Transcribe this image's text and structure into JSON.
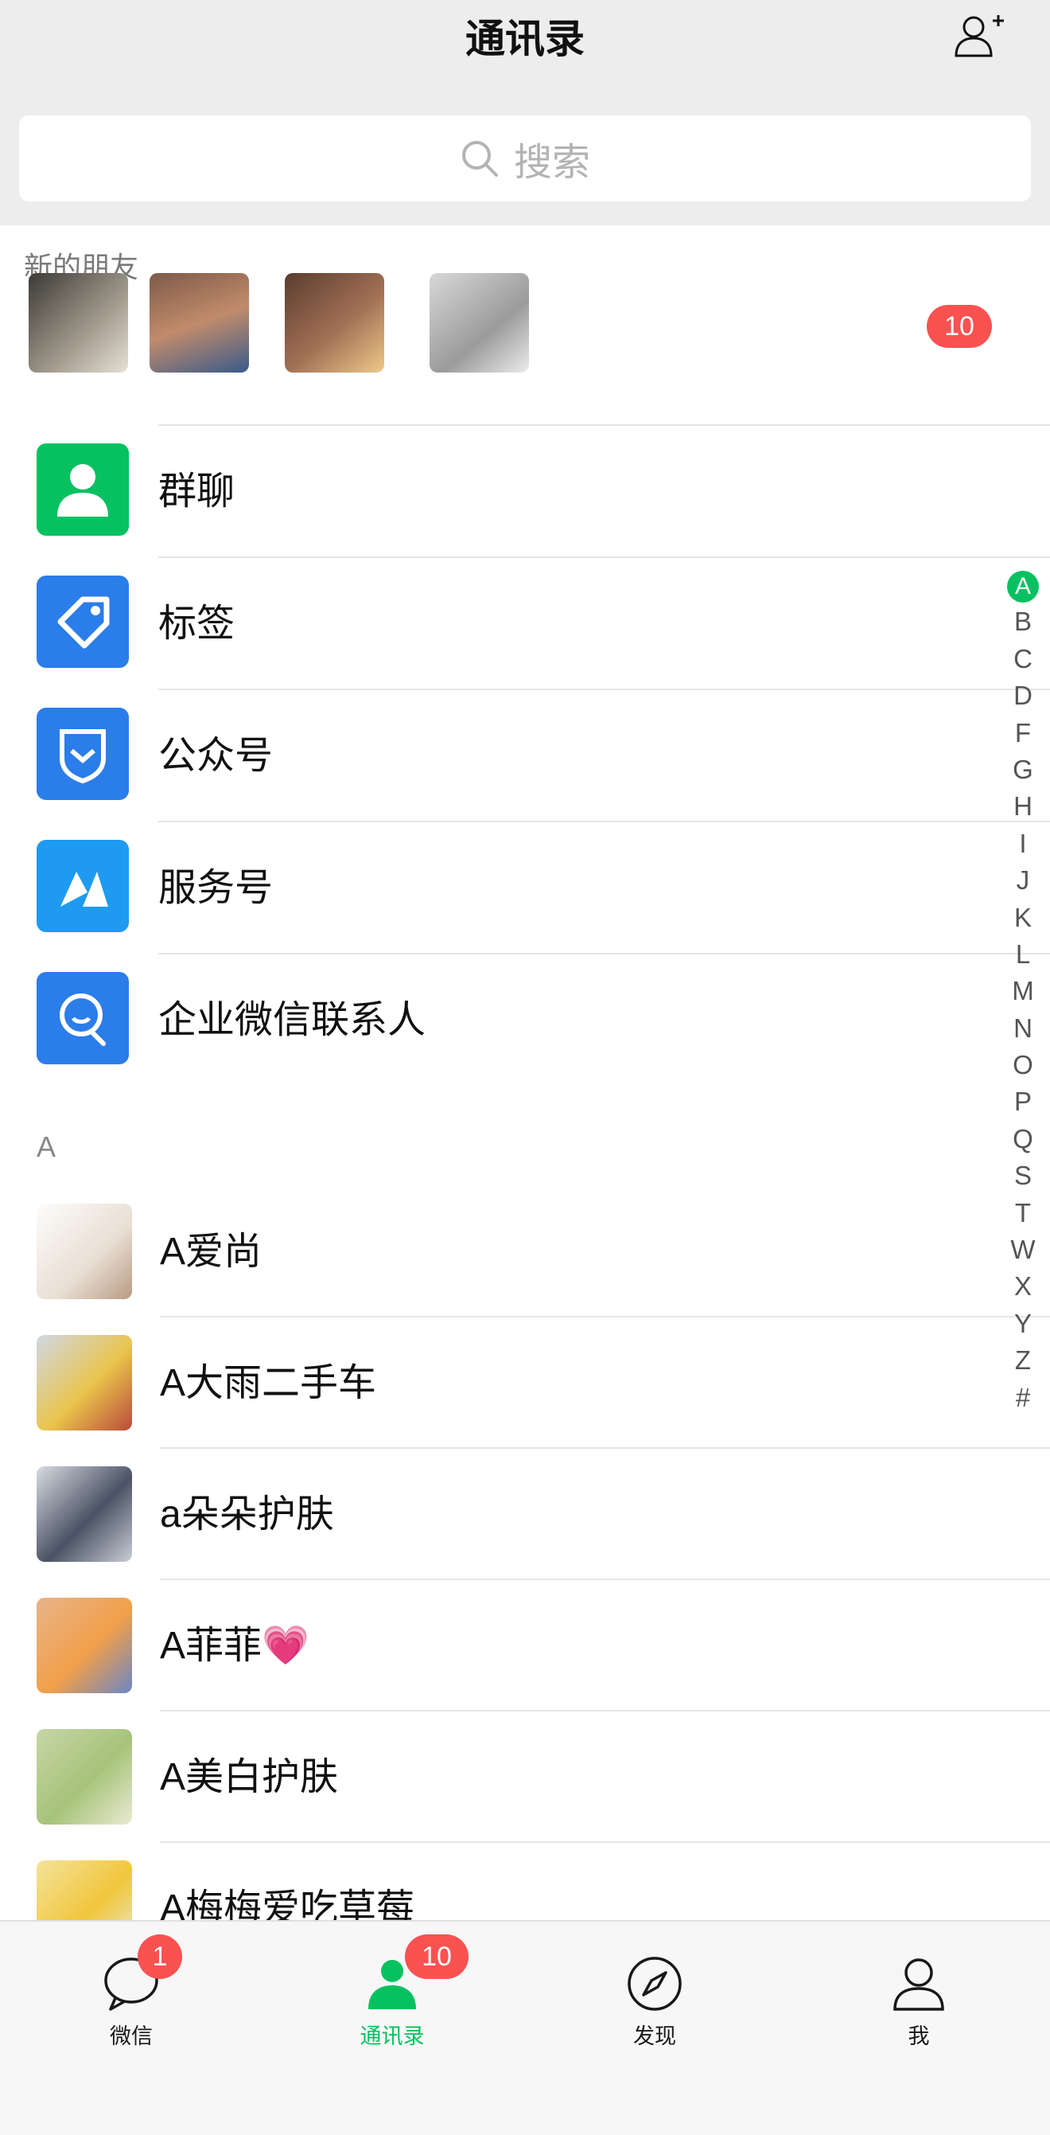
{
  "header": {
    "title": "通讯录",
    "search_placeholder": "搜索"
  },
  "new_friends": {
    "label": "新的朋友",
    "badge": "10"
  },
  "menu": [
    {
      "label": "群聊",
      "icon": "group-chat-icon",
      "color": "#07c160"
    },
    {
      "label": "标签",
      "icon": "tag-icon",
      "color": "#2b7de9"
    },
    {
      "label": "公众号",
      "icon": "official-account-icon",
      "color": "#2b7de9"
    },
    {
      "label": "服务号",
      "icon": "service-account-icon",
      "color": "#1e9bf0"
    },
    {
      "label": "企业微信联系人",
      "icon": "work-contacts-icon",
      "color": "#2b7de9"
    }
  ],
  "section_letter": "A",
  "contacts": [
    {
      "name": "A爱尚"
    },
    {
      "name": "A大雨二手车"
    },
    {
      "name": "a朵朵护肤"
    },
    {
      "name": "A菲菲💗"
    },
    {
      "name": "A美白护肤"
    },
    {
      "name": "A梅梅爱吃草莓"
    }
  ],
  "index_letters": [
    "A",
    "B",
    "C",
    "D",
    "F",
    "G",
    "H",
    "I",
    "J",
    "K",
    "L",
    "M",
    "N",
    "O",
    "P",
    "Q",
    "S",
    "T",
    "W",
    "X",
    "Y",
    "Z",
    "#"
  ],
  "tabs": [
    {
      "label": "微信",
      "icon": "chat-icon",
      "badge": "1"
    },
    {
      "label": "通讯录",
      "icon": "contacts-icon",
      "badge": "10"
    },
    {
      "label": "发现",
      "icon": "discover-icon",
      "badge": ""
    },
    {
      "label": "我",
      "icon": "me-icon",
      "badge": ""
    }
  ],
  "colors": {
    "accent": "#07c160",
    "badge": "#fa5151",
    "header_bg": "#ededed"
  }
}
